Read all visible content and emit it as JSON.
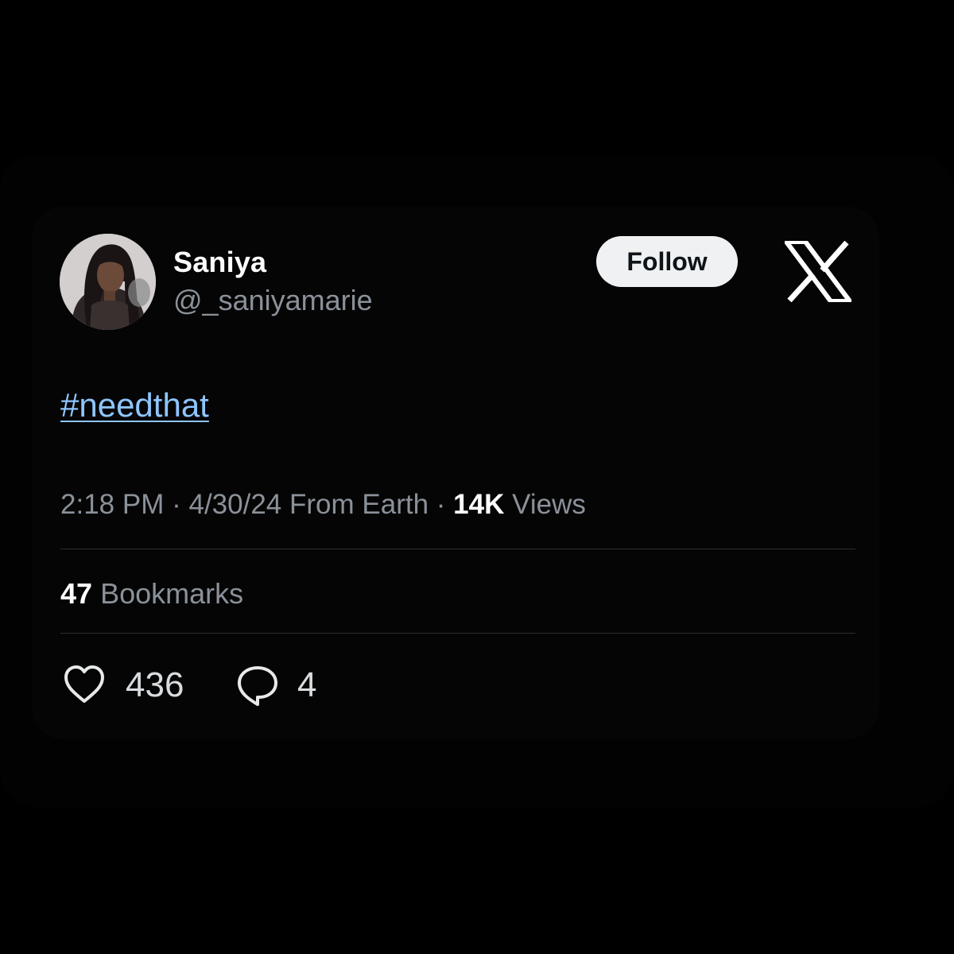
{
  "author": {
    "display_name": "Saniya",
    "handle": "@_saniyamarie"
  },
  "follow_label": "Follow",
  "tweet": {
    "text": "#needthat"
  },
  "meta": {
    "time": "2:18 PM",
    "date": "4/30/24",
    "location": "From Earth",
    "views_count": "14K",
    "views_label": "Views",
    "separator": "·"
  },
  "bookmarks": {
    "count": "47",
    "label": "Bookmarks"
  },
  "actions": {
    "likes": "436",
    "replies": "4"
  },
  "icons": {
    "avatar": "avatar",
    "brand": "x-logo-icon",
    "like": "heart-icon",
    "reply": "reply-bubble-icon"
  },
  "colors": {
    "background": "#000000",
    "hashtag": "#8ec5ff",
    "follow_button": "#eff1f2",
    "secondary_text": "#8b9199"
  }
}
